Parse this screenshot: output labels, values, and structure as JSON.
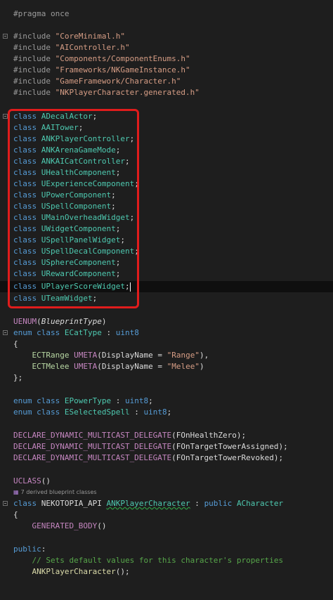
{
  "editor": {
    "lines": {
      "pragma": "#pragma once",
      "inc1": [
        "#include",
        "\"CoreMinimal.h\""
      ],
      "inc2": [
        "#include",
        "\"AIController.h\""
      ],
      "inc3": [
        "#include",
        "\"Components/ComponentEnums.h\""
      ],
      "inc4": [
        "#include",
        "\"Frameworks/NKGameInstance.h\""
      ],
      "inc5": [
        "#include",
        "\"GameFramework/Character.h\""
      ],
      "inc6": [
        "#include",
        "\"NKPlayerCharacter.generated.h\""
      ],
      "fwd": [
        "ADecalActor",
        "AAITower",
        "ANKPlayerController",
        "ANKArenaGameMode",
        "ANKAICatController",
        "UHealthComponent",
        "UExperienceComponent",
        "UPowerComponent",
        "USpellComponent",
        "UMainOverheadWidget",
        "UWidgetComponent",
        "USpellPanelWidget",
        "USpellDecalComponent",
        "USphereComponent",
        "URewardComponent",
        "UPlayerScoreWidget",
        "UTeamWidget"
      ],
      "class_kw": "class",
      "uenum": "UENUM",
      "blueprint_type": "BlueprintType",
      "enum_kw": "enum",
      "ecat": "ECatType",
      "uint8": "uint8",
      "open_brace": "{",
      "close_brace_semi": "};",
      "ectrange": "ECTRange",
      "ectmelee": "ECTMelee",
      "umeta": "UMETA",
      "display_name": "DisplayName",
      "range_str": "\"Range\"",
      "melee_str": "\"Melee\"",
      "epower": "EPowerType",
      "espell": "ESelectedSpell",
      "declare": "DECLARE_DYNAMIC_MULTICAST_DELEGATE",
      "d1": "FOnHealthZero",
      "d2": "FOnTargetTowerAssigned",
      "d3": "FOnTargetTowerRevoked",
      "uclass": "UCLASS",
      "codelens": "7 derived blueprint classes",
      "api": "NEKOTOPIA_API",
      "class_name": "ANKPlayerCharacter",
      "public_kw": "public",
      "base": "ACharacter",
      "generated_body": "GENERATED_BODY",
      "public_label": "public",
      "comment": "// Sets default values for this character's properties",
      "ctor": "ANKPlayerCharacter"
    }
  },
  "colors": {
    "background": "#1e1e1e",
    "keyword": "#569cd6",
    "string": "#d69d85",
    "macro": "#c586c0",
    "comment": "#57a64a",
    "highlight_box": "#e01c1c"
  },
  "icons": {
    "codelens": "blueprint-icon"
  }
}
